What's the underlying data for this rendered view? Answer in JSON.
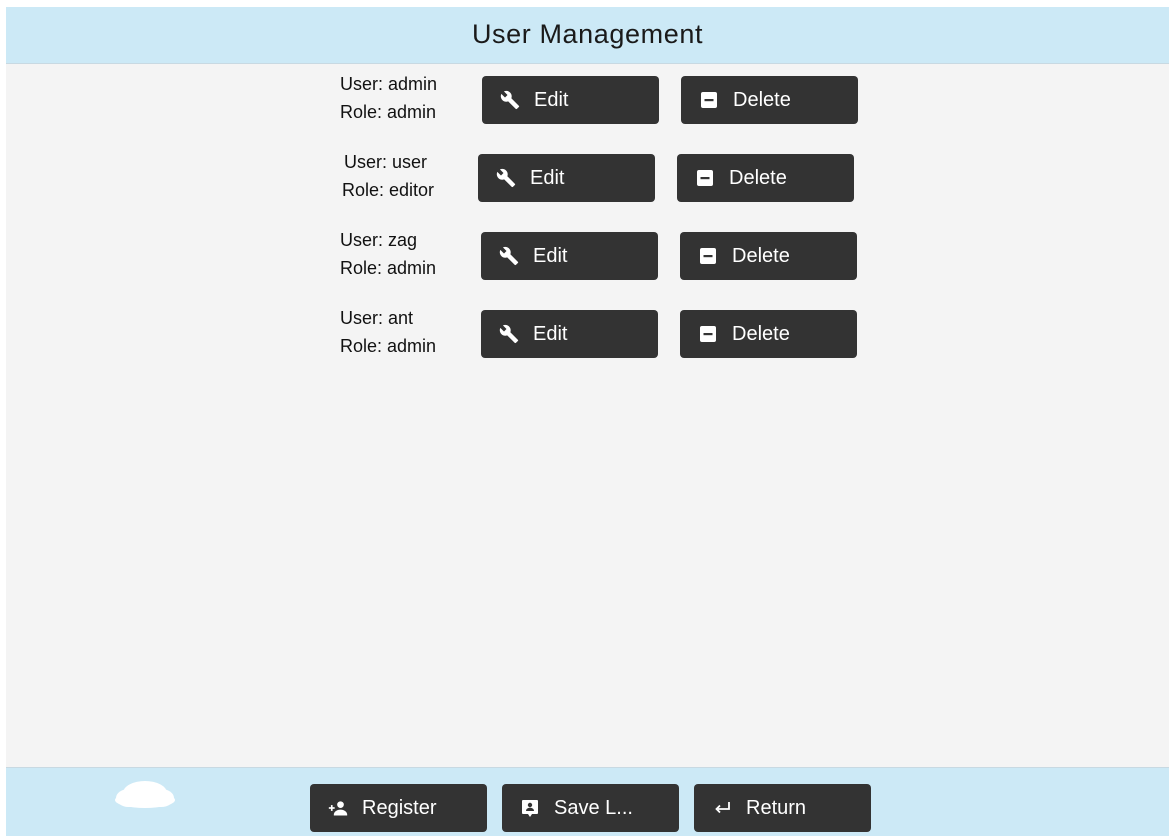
{
  "header": {
    "title": "User Management"
  },
  "users": [
    {
      "user_text": "User: admin",
      "role_text": "Role: admin"
    },
    {
      "user_text": "User: user",
      "role_text": "Role: editor"
    },
    {
      "user_text": "User: zag",
      "role_text": "Role: admin"
    },
    {
      "user_text": "User: ant",
      "role_text": "Role: admin"
    }
  ],
  "actions": {
    "edit_label": "Edit",
    "delete_label": "Delete",
    "edit_icon": "wrench-icon",
    "delete_icon": "minus-box-icon"
  },
  "footer": {
    "register_label": "Register",
    "register_icon": "add-user-icon",
    "save_label": "Save L...",
    "save_icon": "save-comment-icon",
    "return_label": "Return",
    "return_icon": "return-arrow-icon",
    "cloud_icon": "cloud-icon"
  },
  "colors": {
    "header_bg": "#cce9f6",
    "body_bg": "#f4f4f4",
    "button_bg": "#333333",
    "button_text": "#ffffff"
  }
}
